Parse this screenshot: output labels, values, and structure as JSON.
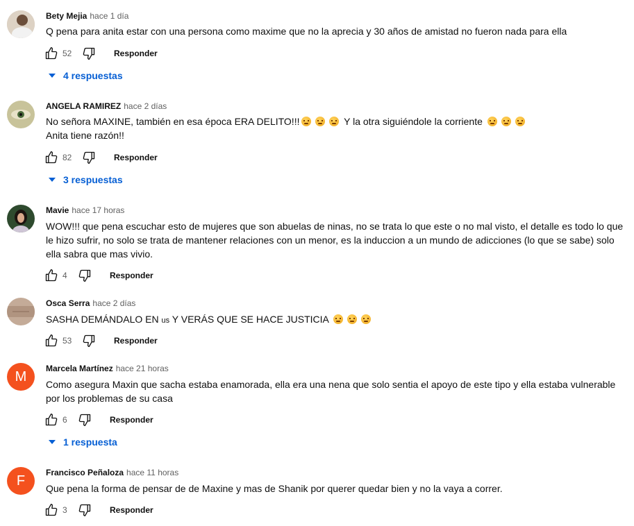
{
  "actions": {
    "reply_label": "Responder"
  },
  "emoji_name": "angry-face-emoji",
  "comments": [
    {
      "author": "Bety Mejia",
      "time": "hace 1 día",
      "text": "Q pena para anita estar con una persona como maxime  que no la aprecia y 30 años de amistad no fueron nada para ella",
      "likes": "52",
      "replies": "4 respuestas"
    },
    {
      "author": "ANGELA RAMIREZ",
      "time": "hace 2 días",
      "text_part1": "No señora MAXINE, también en esa época ERA DELITO!!!",
      "text_part2": " Y la otra siguiéndole la corriente ",
      "text_line2": "Anita tiene razón!!",
      "likes": "82",
      "replies": "3 respuestas"
    },
    {
      "author": "Mavie",
      "time": "hace 17 horas",
      "text": "WOW!!! que pena escuchar esto de mujeres que son abuelas de ninas, no se trata lo que este o no mal visto, el detalle es todo lo que le hizo sufrir, no solo se trata de mantener relaciones con un menor, es la induccion a un mundo de adicciones (lo que se sabe) solo ella sabra que mas vivio.",
      "likes": "4"
    },
    {
      "author": "Osca Serra",
      "time": "hace 2 días",
      "text_part1": "SASHA DEMÁNDALO EN ",
      "text_small": "us",
      "text_part2": " Y VERÁS QUE SE HACE JUSTICIA ",
      "likes": "53"
    },
    {
      "author": "Marcela Martínez",
      "time": "hace 21 horas",
      "avatar_letter": "M",
      "text": "Como asegura Maxin que sacha estaba enamorada, ella era una nena  que solo sentia el apoyo de este tipo y ella estaba vulnerable por los problemas de su casa",
      "likes": "6",
      "replies": "1 respuesta"
    },
    {
      "author": "Francisco Peñaloza",
      "time": "hace 11 horas",
      "avatar_letter": "F",
      "text": "Que pena la forma de pensar de de Maxine y mas de Shanik por querer quedar bien y no la vaya a correr.",
      "likes": "3"
    }
  ],
  "colors": {
    "link": "#065fd4",
    "avatar_m": "#f4511e",
    "avatar_f": "#f4511e",
    "secondary": "#606060"
  }
}
